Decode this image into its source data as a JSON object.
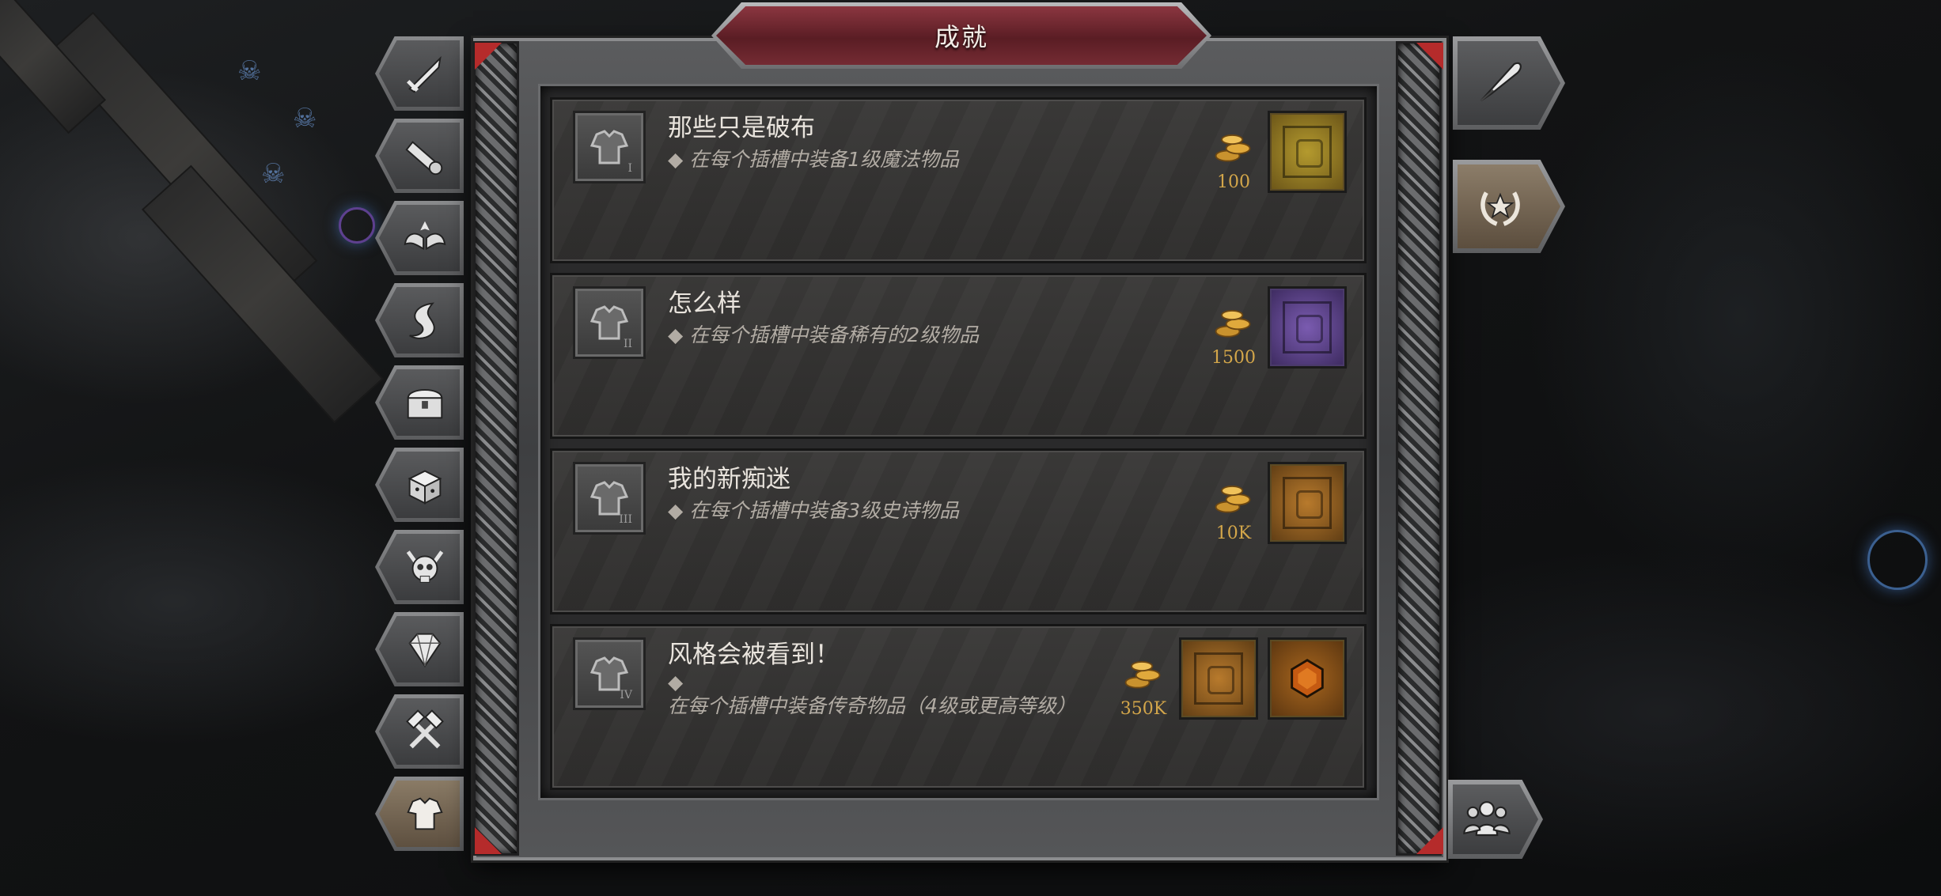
{
  "window": {
    "title": "成就"
  },
  "achievements": [
    {
      "title": "那些只是破布",
      "bullet": "◆",
      "description": "在每个插槽中装备1级魔法物品",
      "tier": "I",
      "gold": "100",
      "rewards": [
        {
          "type": "cube",
          "color": "#8a7a23"
        }
      ]
    },
    {
      "title": "怎么样",
      "bullet": "◆",
      "description": "在每个插槽中装备稀有的2级物品",
      "tier": "II",
      "gold": "1500",
      "rewards": [
        {
          "type": "cube",
          "color": "#5b3f86"
        }
      ]
    },
    {
      "title": "我的新痴迷",
      "bullet": "◆",
      "description": "在每个插槽中装备3级史诗物品",
      "tier": "III",
      "gold": "10K",
      "rewards": [
        {
          "type": "cube",
          "color": "#8a5a22"
        }
      ]
    },
    {
      "title": "风格会被看到！",
      "bullet": "◆",
      "description": "在每个插槽中装备传奇物品（4级或更高等级）",
      "tier": "IV",
      "gold": "350K",
      "rewards": [
        {
          "type": "cube",
          "color": "#8a5a22"
        },
        {
          "type": "gem",
          "color": "#b05a16"
        }
      ]
    }
  ],
  "left_tabs": [
    {
      "name": "weapon",
      "icon": "sword-icon"
    },
    {
      "name": "scroll",
      "icon": "scroll-icon"
    },
    {
      "name": "wings",
      "icon": "wings-icon"
    },
    {
      "name": "horn",
      "icon": "horn-icon"
    },
    {
      "name": "chest",
      "icon": "chest-icon"
    },
    {
      "name": "dice",
      "icon": "dice-icon"
    },
    {
      "name": "skull",
      "icon": "skull-icon"
    },
    {
      "name": "gem",
      "icon": "diamond-icon"
    },
    {
      "name": "craft",
      "icon": "hammer-icon"
    },
    {
      "name": "equipment",
      "icon": "armor-icon",
      "active": true
    }
  ],
  "right_buttons": [
    {
      "name": "quill",
      "icon": "quill-icon"
    },
    {
      "name": "achievements",
      "icon": "laurel-star-icon",
      "active": true
    },
    {
      "name": "social",
      "icon": "group-icon"
    }
  ],
  "colors": {
    "gold": "#d3a64a",
    "title_banner": "#6b2530",
    "accent_red": "#b52b2b"
  }
}
